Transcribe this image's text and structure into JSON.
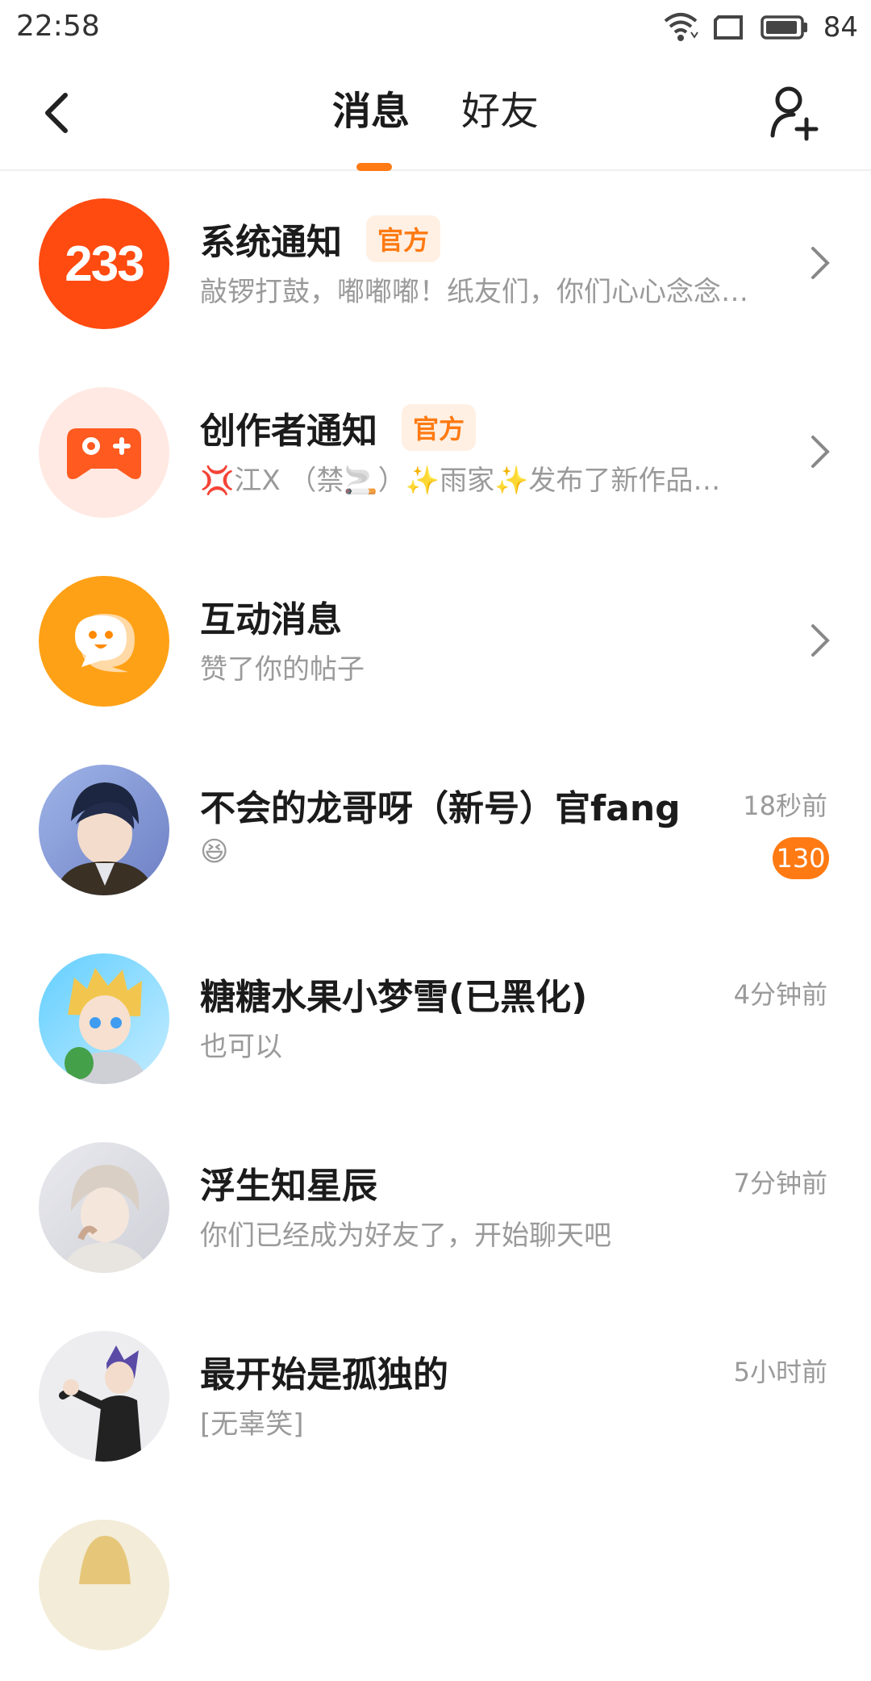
{
  "status_bar": {
    "time": "22:58",
    "battery": "84"
  },
  "header": {
    "tabs": [
      {
        "label": "消息"
      },
      {
        "label": "好友"
      }
    ]
  },
  "messages": [
    {
      "title": "系统通知",
      "badge": "官方",
      "preview": "敲锣打鼓，嘟嘟嘟！纸友们，你们心心念念…",
      "avatar_text": "233"
    },
    {
      "title": "创作者通知",
      "badge": "官方",
      "preview": "💢江X （禁🚬）✨雨家✨发布了新作品…"
    },
    {
      "title": "互动消息",
      "preview": "赞了你的帖子"
    },
    {
      "title": "不会的龙哥呀（新号）官fang",
      "preview": "😆",
      "time": "18秒前",
      "unread": "130"
    },
    {
      "title": "糖糖水果小梦雪(已黑化)",
      "preview": "也可以",
      "time": "4分钟前"
    },
    {
      "title": "浮生知星辰",
      "preview": "你们已经成为好友了，开始聊天吧",
      "time": "7分钟前"
    },
    {
      "title": "最开始是孤独的",
      "preview": "[无辜笑]",
      "time": "5小时前"
    }
  ],
  "colors": {
    "accent": "#ff7a13",
    "system_avatar": "#ff4a10",
    "interactive_avatar": "#ffa116"
  }
}
